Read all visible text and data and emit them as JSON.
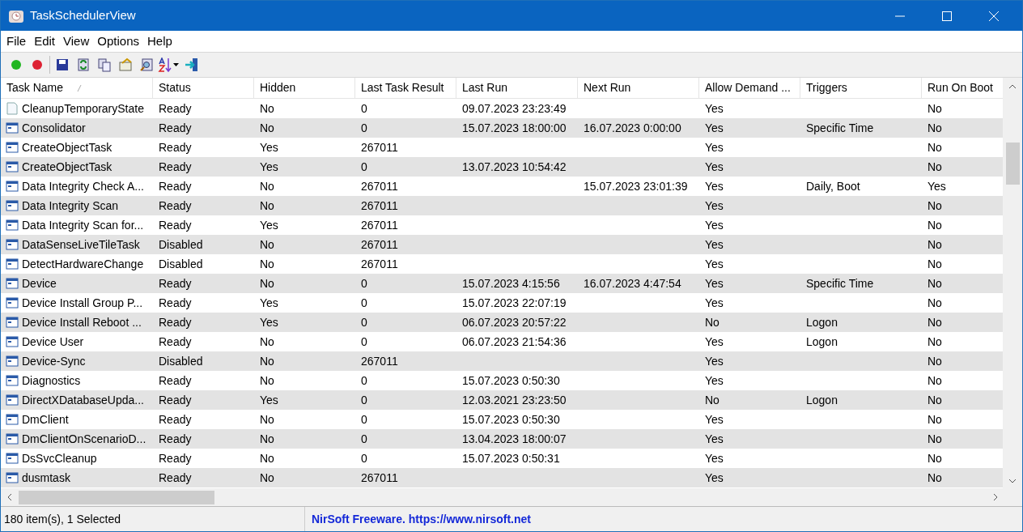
{
  "window": {
    "title": "TaskSchedulerView"
  },
  "menu": [
    "File",
    "Edit",
    "View",
    "Options",
    "Help"
  ],
  "table": {
    "columns": [
      {
        "label": "Task Name",
        "sorted": true
      },
      {
        "label": "Status",
        "sorted": false
      },
      {
        "label": "Hidden",
        "sorted": false
      },
      {
        "label": "Last Task Result",
        "sorted": false
      },
      {
        "label": "Last Run",
        "sorted": false
      },
      {
        "label": "Next Run",
        "sorted": false
      },
      {
        "label": "Allow Demand ...",
        "sorted": false
      },
      {
        "label": "Triggers",
        "sorted": false
      },
      {
        "label": "Run On Boot",
        "sorted": false
      }
    ],
    "rows": [
      {
        "kind": "file",
        "cells": [
          "CleanupTemporaryState",
          "Ready",
          "No",
          "0",
          "09.07.2023 23:23:49",
          "",
          "Yes",
          "",
          "No"
        ]
      },
      {
        "kind": "task",
        "cells": [
          "Consolidator",
          "Ready",
          "No",
          "0",
          "15.07.2023 18:00:00",
          "16.07.2023 0:00:00",
          "Yes",
          "Specific Time",
          "No"
        ]
      },
      {
        "kind": "task",
        "cells": [
          "CreateObjectTask",
          "Ready",
          "Yes",
          "267011",
          "",
          "",
          "Yes",
          "",
          "No"
        ]
      },
      {
        "kind": "task",
        "cells": [
          "CreateObjectTask",
          "Ready",
          "Yes",
          "0",
          "13.07.2023 10:54:42",
          "",
          "Yes",
          "",
          "No"
        ]
      },
      {
        "kind": "task",
        "cells": [
          "Data Integrity Check A...",
          "Ready",
          "No",
          "267011",
          "",
          "15.07.2023 23:01:39",
          "Yes",
          "Daily, Boot",
          "Yes"
        ]
      },
      {
        "kind": "task",
        "cells": [
          "Data Integrity Scan",
          "Ready",
          "No",
          "267011",
          "",
          "",
          "Yes",
          "",
          "No"
        ]
      },
      {
        "kind": "task",
        "cells": [
          "Data Integrity Scan for...",
          "Ready",
          "Yes",
          "267011",
          "",
          "",
          "Yes",
          "",
          "No"
        ]
      },
      {
        "kind": "task",
        "cells": [
          "DataSenseLiveTileTask",
          "Disabled",
          "No",
          "267011",
          "",
          "",
          "Yes",
          "",
          "No"
        ]
      },
      {
        "kind": "task",
        "cells": [
          "DetectHardwareChange",
          "Disabled",
          "No",
          "267011",
          "",
          "",
          "Yes",
          "",
          "No"
        ]
      },
      {
        "kind": "task",
        "cells": [
          "Device",
          "Ready",
          "No",
          "0",
          "15.07.2023 4:15:56",
          "16.07.2023 4:47:54",
          "Yes",
          "Specific Time",
          "No"
        ]
      },
      {
        "kind": "task",
        "cells": [
          "Device Install Group P...",
          "Ready",
          "Yes",
          "0",
          "15.07.2023 22:07:19",
          "",
          "Yes",
          "",
          "No"
        ]
      },
      {
        "kind": "task",
        "cells": [
          "Device Install Reboot ...",
          "Ready",
          "Yes",
          "0",
          "06.07.2023 20:57:22",
          "",
          "No",
          "Logon",
          "No"
        ]
      },
      {
        "kind": "task",
        "cells": [
          "Device User",
          "Ready",
          "No",
          "0",
          "06.07.2023 21:54:36",
          "",
          "Yes",
          "Logon",
          "No"
        ]
      },
      {
        "kind": "task",
        "cells": [
          "Device-Sync",
          "Disabled",
          "No",
          "267011",
          "",
          "",
          "Yes",
          "",
          "No"
        ]
      },
      {
        "kind": "task",
        "cells": [
          "Diagnostics",
          "Ready",
          "No",
          "0",
          "15.07.2023 0:50:30",
          "",
          "Yes",
          "",
          "No"
        ]
      },
      {
        "kind": "task",
        "cells": [
          "DirectXDatabaseUpda...",
          "Ready",
          "Yes",
          "0",
          "12.03.2021 23:23:50",
          "",
          "No",
          "Logon",
          "No"
        ]
      },
      {
        "kind": "task",
        "cells": [
          "DmClient",
          "Ready",
          "No",
          "0",
          "15.07.2023 0:50:30",
          "",
          "Yes",
          "",
          "No"
        ]
      },
      {
        "kind": "task",
        "cells": [
          "DmClientOnScenarioD...",
          "Ready",
          "No",
          "0",
          "13.04.2023 18:00:07",
          "",
          "Yes",
          "",
          "No"
        ]
      },
      {
        "kind": "task",
        "cells": [
          "DsSvcCleanup",
          "Ready",
          "No",
          "0",
          "15.07.2023 0:50:31",
          "",
          "Yes",
          "",
          "No"
        ]
      },
      {
        "kind": "task",
        "cells": [
          "dusmtask",
          "Ready",
          "No",
          "267011",
          "",
          "",
          "Yes",
          "",
          "No"
        ]
      }
    ]
  },
  "status_bar": {
    "count": "180 item(s), 1 Selected",
    "link": "NirSoft Freeware. https://www.nirsoft.net"
  }
}
